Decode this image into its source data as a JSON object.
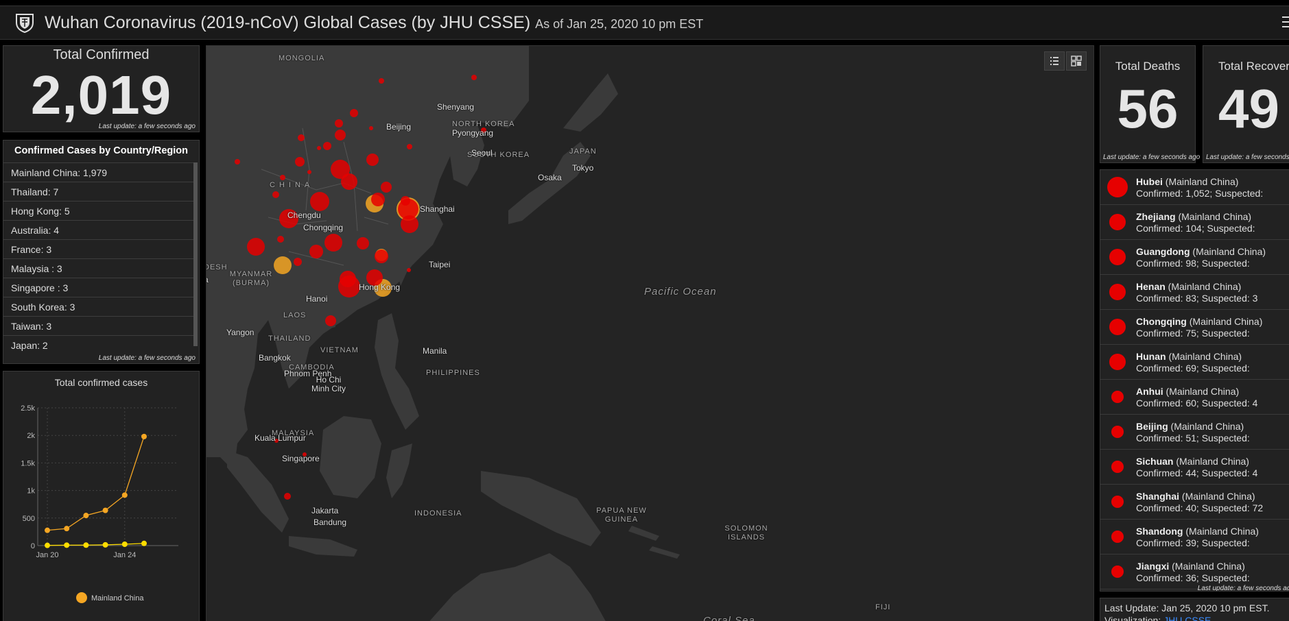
{
  "header": {
    "title": "Wuhan Coronavirus (2019-nCoV) Global Cases (by JHU CSSE)",
    "subtitle": "As of Jan 25, 2020 10 pm EST",
    "logo_icon": "university-shield-logo-icon",
    "menu_icon": "hamburger-menu-icon"
  },
  "total_confirmed": {
    "label": "Total Confirmed",
    "value": "2,019",
    "last_update": "Last update: a few seconds ago"
  },
  "country_panel": {
    "title": "Confirmed Cases by Country/Region",
    "items": [
      {
        "label": "Mainland China:  1,979"
      },
      {
        "label": "Thailand:  7"
      },
      {
        "label": "Hong Kong:  5"
      },
      {
        "label": "Australia:  4"
      },
      {
        "label": "France:  3"
      },
      {
        "label": "Malaysia :  3"
      },
      {
        "label": "Singapore :  3"
      },
      {
        "label": "South Korea:  3"
      },
      {
        "label": "Taiwan:  3"
      },
      {
        "label": "Japan:  2"
      }
    ],
    "last_update": "Last update: a few seconds ago"
  },
  "chart_data": {
    "type": "line",
    "title": "Total confirmed cases",
    "x": [
      "Jan 20",
      "Jan 21",
      "Jan 22",
      "Jan 23",
      "Jan 24",
      "Jan 25"
    ],
    "x_tick_labels": [
      "Jan 20",
      "Jan 24"
    ],
    "ylim": [
      0,
      2500
    ],
    "y_ticks": [
      "0",
      "500",
      "1k",
      "1.5k",
      "2k",
      "2.5k"
    ],
    "grid": true,
    "legend": "bottom",
    "series": [
      {
        "name": "Mainland China",
        "color": "#f5a623",
        "values": [
          278,
          309,
          547,
          639,
          916,
          1979
        ]
      },
      {
        "name": "",
        "color": "#ffdd00",
        "values": [
          4,
          8,
          9,
          14,
          25,
          40
        ]
      }
    ]
  },
  "map": {
    "labels": [
      {
        "text": "MONGOLIA",
        "kind": "country"
      },
      {
        "text": "CHINA",
        "kind": "country"
      },
      {
        "text": "NORTH KOREA",
        "kind": "country"
      },
      {
        "text": "SOUTH KOREA",
        "kind": "country"
      },
      {
        "text": "JAPAN",
        "kind": "country"
      },
      {
        "text": "MYANMAR (BURMA)",
        "kind": "country"
      },
      {
        "text": "LAOS",
        "kind": "country"
      },
      {
        "text": "THAILAND",
        "kind": "country"
      },
      {
        "text": "VIETNAM",
        "kind": "country"
      },
      {
        "text": "CAMBODIA",
        "kind": "country"
      },
      {
        "text": "PHILIPPINES",
        "kind": "country"
      },
      {
        "text": "MALAYSIA",
        "kind": "country"
      },
      {
        "text": "INDONESIA",
        "kind": "country"
      },
      {
        "text": "PAPUA NEW GUINEA",
        "kind": "country"
      },
      {
        "text": "SOLOMON ISLANDS",
        "kind": "country"
      },
      {
        "text": "FIJI",
        "kind": "country"
      },
      {
        "text": "DESH",
        "kind": "country"
      },
      {
        "text": "a",
        "kind": "city"
      },
      {
        "text": "Shenyang",
        "kind": "city"
      },
      {
        "text": "Beijing",
        "kind": "city"
      },
      {
        "text": "Pyongyang",
        "kind": "city"
      },
      {
        "text": "Seoul",
        "kind": "city"
      },
      {
        "text": "Tokyo",
        "kind": "city"
      },
      {
        "text": "Osaka",
        "kind": "city"
      },
      {
        "text": "Chengdu",
        "kind": "city"
      },
      {
        "text": "Chongqing",
        "kind": "city"
      },
      {
        "text": "Shanghai",
        "kind": "city"
      },
      {
        "text": "Taipei",
        "kind": "city"
      },
      {
        "text": "Hong Kong",
        "kind": "city"
      },
      {
        "text": "Hanoi",
        "kind": "city"
      },
      {
        "text": "Yangon",
        "kind": "city"
      },
      {
        "text": "Bangkok",
        "kind": "city"
      },
      {
        "text": "Phnom Penh",
        "kind": "city"
      },
      {
        "text": "Ho Chi Minh City",
        "kind": "city"
      },
      {
        "text": "Manila",
        "kind": "city"
      },
      {
        "text": "Kuala Lumpur",
        "kind": "city"
      },
      {
        "text": "Singapore",
        "kind": "city"
      },
      {
        "text": "Jakarta",
        "kind": "city"
      },
      {
        "text": "Bandung",
        "kind": "city"
      },
      {
        "text": "Pacific Ocean",
        "kind": "ocean"
      },
      {
        "text": "Coral Sea",
        "kind": "ocean"
      }
    ],
    "buttons": [
      {
        "icon": "list-view-icon"
      },
      {
        "icon": "qr-grid-icon"
      }
    ]
  },
  "total_deaths": {
    "label": "Total Deaths",
    "value": "56",
    "last_update": "Last update: a few seconds ago"
  },
  "total_recovered": {
    "label": "Total Recovered",
    "value": "49",
    "last_update": "Last update: a few seconds ago"
  },
  "regions": {
    "items": [
      {
        "name": "Hubei",
        "country": "(Mainland China)",
        "detail": "Confirmed: 1,052; Suspected:"
      },
      {
        "name": "Zhejiang",
        "country": "(Mainland China)",
        "detail": "Confirmed: 104; Suspected:"
      },
      {
        "name": "Guangdong",
        "country": "(Mainland China)",
        "detail": "Confirmed: 98; Suspected:"
      },
      {
        "name": "Henan",
        "country": "(Mainland China)",
        "detail": "Confirmed: 83; Suspected: 3"
      },
      {
        "name": "Chongqing",
        "country": "(Mainland China)",
        "detail": "Confirmed: 75; Suspected:"
      },
      {
        "name": "Hunan",
        "country": "(Mainland China)",
        "detail": "Confirmed: 69; Suspected:"
      },
      {
        "name": "Anhui",
        "country": "(Mainland China)",
        "detail": "Confirmed: 60; Suspected: 4"
      },
      {
        "name": "Beijing",
        "country": "(Mainland China)",
        "detail": "Confirmed: 51; Suspected:"
      },
      {
        "name": "Sichuan",
        "country": "(Mainland China)",
        "detail": "Confirmed: 44; Suspected: 4"
      },
      {
        "name": "Shanghai",
        "country": "(Mainland China)",
        "detail": "Confirmed: 40; Suspected: 72"
      },
      {
        "name": "Shandong",
        "country": "(Mainland China)",
        "detail": "Confirmed: 39; Suspected:"
      },
      {
        "name": "Jiangxi",
        "country": "(Mainland China)",
        "detail": "Confirmed: 36; Suspected:"
      }
    ],
    "last_update": "Last update: a few seconds ago"
  },
  "footer": {
    "line1": "Last Update: Jan 25, 2020 10 pm EST.",
    "line2_prefix": "Visualization: ",
    "line2_link": "JHU CSSE"
  },
  "colors": {
    "case_dot": "#e60000",
    "recovered_ring": "#f5a623",
    "background": "#000000",
    "panel": "#222222",
    "link": "#3b8cff"
  }
}
